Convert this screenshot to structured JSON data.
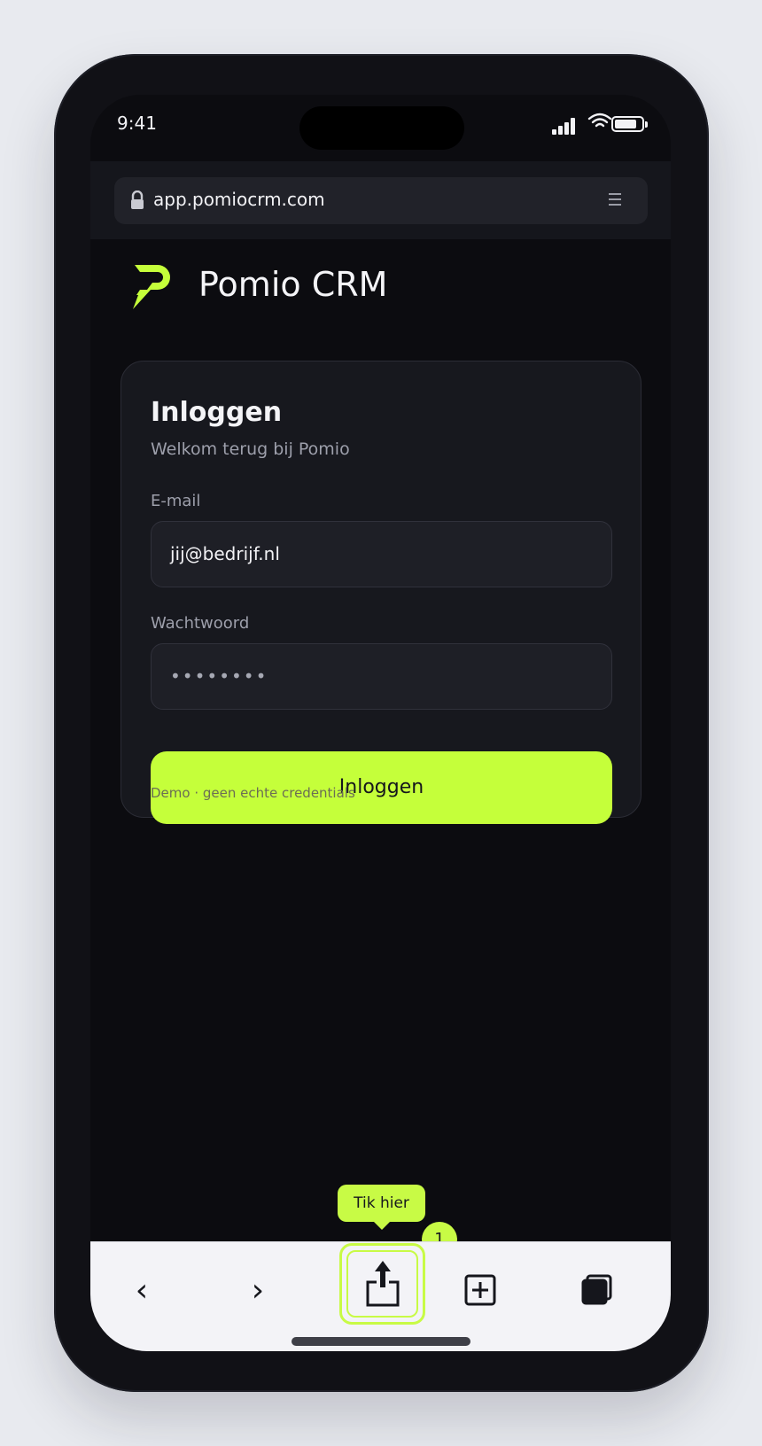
{
  "status_bar": {
    "time": "9:41"
  },
  "browser": {
    "url": "app.pomiocrm.com",
    "toolbar": {
      "back": "‹",
      "forward": "›"
    }
  },
  "brand": {
    "name": "Pomio CRM",
    "accent_color": "#c5ff3a"
  },
  "login_card": {
    "title": "Inloggen",
    "subtitle": "Welkom terug bij Pomio",
    "email_label": "E-mail",
    "email_value": "jij@bedrijf.nl",
    "password_label": "Wachtwoord",
    "password_value": "••••••••",
    "submit_label": "Inloggen",
    "demo_note": "Demo · geen echte credentials"
  },
  "tutorial": {
    "tooltip": "Tik hier",
    "step": "1"
  },
  "icons": {
    "lock": "lock-icon",
    "menu": "menu-icon",
    "share": "share-icon",
    "add_bookmark": "add-bookmark-icon",
    "tabs": "tabs-icon"
  }
}
